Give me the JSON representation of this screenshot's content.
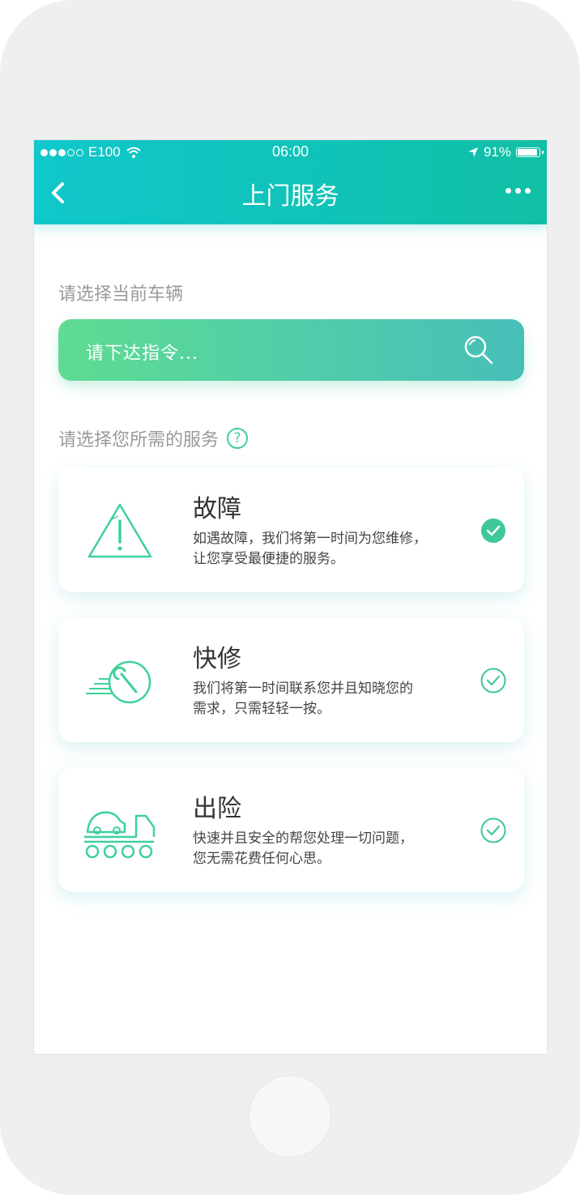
{
  "status_bar": {
    "carrier": "E100",
    "time": "06:00",
    "battery": "91%"
  },
  "nav": {
    "title": "上门服务"
  },
  "vehicle_section": {
    "label": "请选择当前车辆",
    "placeholder": "请下达指令..."
  },
  "service_section": {
    "label": "请选择您所需的服务",
    "cards": [
      {
        "title": "故障",
        "desc_line1": "如遇故障，我们将第一时间为您维修，",
        "desc_line2": "让您享受最便捷的服务。",
        "icon": "warning-triangle-icon",
        "selected": true
      },
      {
        "title": "快修",
        "desc_line1": "我们将第一时间联系您并且知晓您的",
        "desc_line2": "需求，只需轻轻一按。",
        "icon": "wrench-icon",
        "selected": false
      },
      {
        "title": "出险",
        "desc_line1": "快速并且安全的帮您处理一切问题，",
        "desc_line2": "您无需花费任何心思。",
        "icon": "tow-truck-icon",
        "selected": false
      }
    ]
  },
  "colors": {
    "accent": "#3fd19a",
    "header_start": "#10c7cb",
    "header_end": "#11bfa4"
  }
}
